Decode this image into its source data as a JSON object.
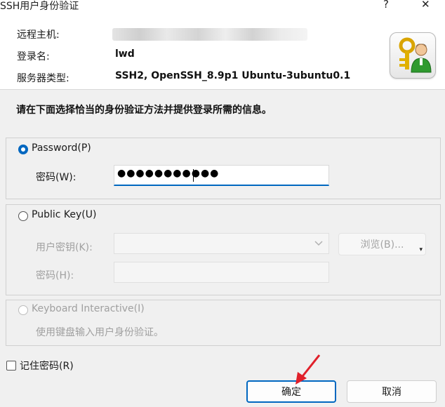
{
  "window": {
    "title": "SSH用户身份验证",
    "help_glyph": "?",
    "close_glyph": "✕"
  },
  "info": {
    "remote_host_label": "远程主机:",
    "login_name_label": "登录名:",
    "login_name_value": "lwd",
    "server_type_label": "服务器类型:",
    "server_type_value": "SSH2, OpenSSH_8.9p1 Ubuntu-3ubuntu0.1"
  },
  "instruction": "请在下面选择恰当的身份验证方法并提供登录所需的信息。",
  "password_method": {
    "label": "Password(P)",
    "selected": true,
    "password_label": "密码(W):",
    "password_value": "●●●●●●●●●●●"
  },
  "publickey_method": {
    "label": "Public Key(U)",
    "selected": false,
    "user_key_label": "用户密钥(K):",
    "browse_label": "浏览(B)...",
    "passphrase_label": "密码(H):"
  },
  "keyboard_method": {
    "label": "Keyboard Interactive(I)",
    "selected": false,
    "description": "使用键盘输入用户身份验证。"
  },
  "remember": {
    "label": "记住密码(R)",
    "checked": false
  },
  "buttons": {
    "ok": "确定",
    "cancel": "取消"
  },
  "colors": {
    "accent": "#0067c0",
    "annotation_arrow": "#e0202a"
  },
  "icons": [
    "help-icon",
    "close-icon",
    "user-key-icon",
    "chevron-down-icon",
    "annotation-arrow-icon"
  ]
}
